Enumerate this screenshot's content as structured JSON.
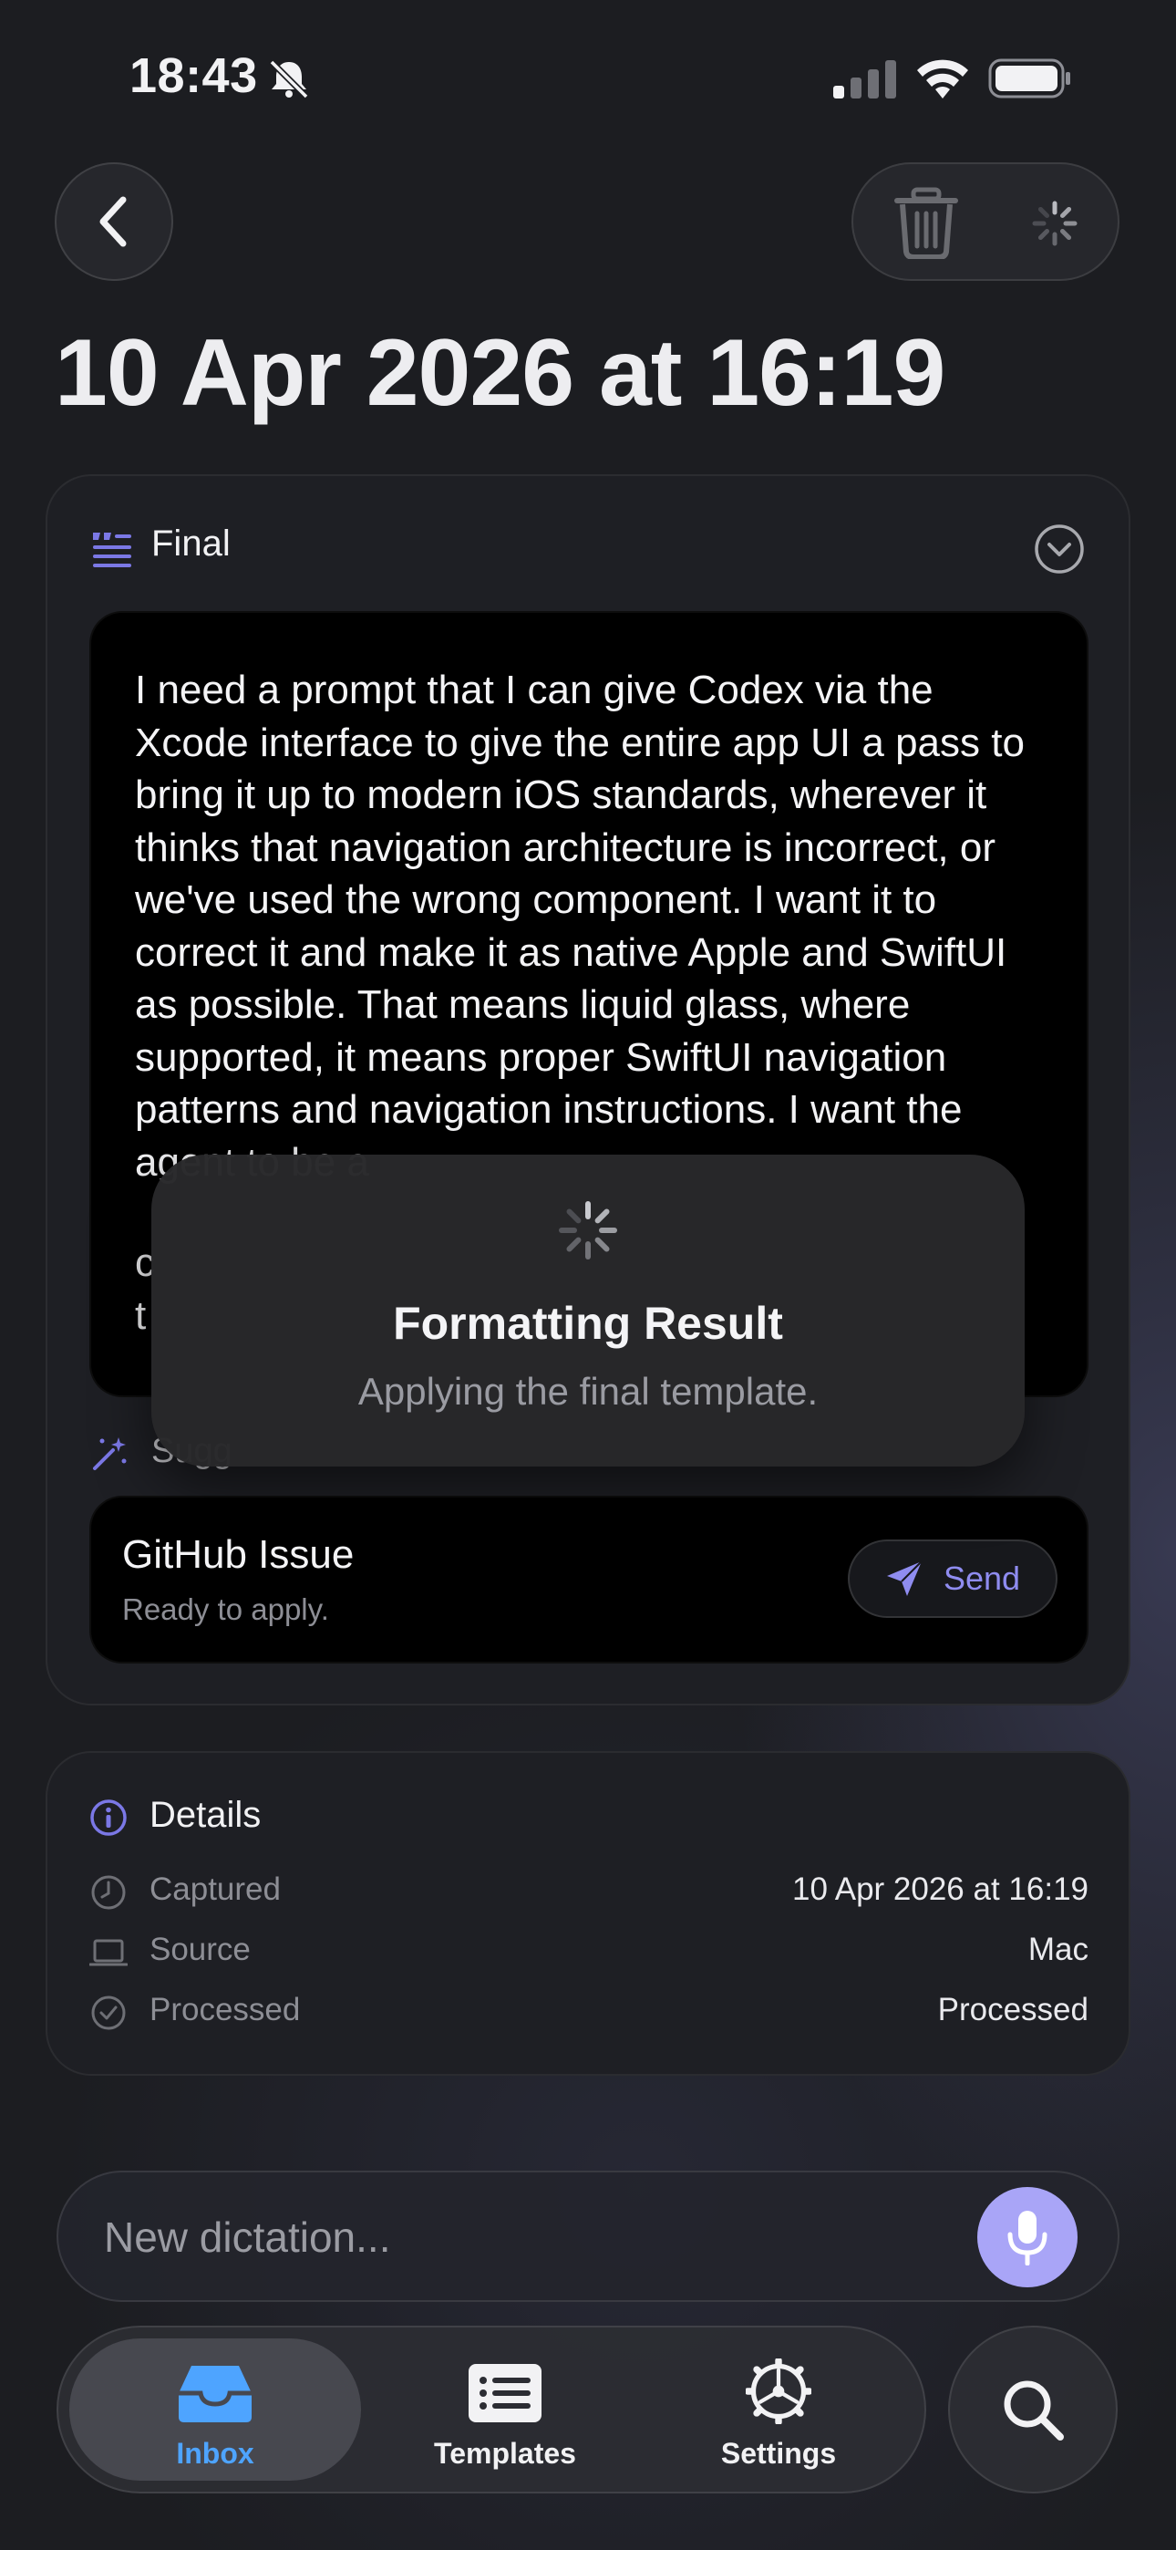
{
  "status_bar": {
    "time": "18:43",
    "icons": [
      "bell-slash-icon",
      "cellular-signal-icon",
      "wifi-icon",
      "battery-icon"
    ]
  },
  "header": {
    "title": "10 Apr 2026 at 16:19",
    "back_icon": "chevron-left-icon",
    "actions": [
      "trash-icon",
      "activity-spinner-icon"
    ]
  },
  "final_section": {
    "label": "Final",
    "icon": "text-quote-icon",
    "collapse_icon": "chevron-down-circle-icon",
    "text": "I need a prompt that I can give Codex via the Xcode interface to give the entire app UI a pass to bring it up to modern iOS standards, wherever it thinks that navigation architecture is incorrect, or we've used the wrong component. I want it to correct it and make it as native Apple and SwiftUI as possible. That means liquid glass, where supported, it means proper SwiftUI navigation patterns and navigation instructions. I want the agent to be a",
    "text_tail_lines": [
      "c",
      "t"
    ]
  },
  "suggestion": {
    "label": "Sugg",
    "icon": "magic-wand-icon",
    "template_name": "GitHub Issue",
    "template_status": "Ready to apply.",
    "send_label": "Send",
    "send_icon": "paper-plane-icon"
  },
  "overlay": {
    "title": "Formatting Result",
    "subtitle": "Applying the final template."
  },
  "details": {
    "label": "Details",
    "icon": "info-circle-icon",
    "rows": [
      {
        "label": "Captured",
        "value": "10 Apr 2026 at 16:19",
        "icon": "clock-icon"
      },
      {
        "label": "Source",
        "value": "Mac",
        "icon": "laptop-icon"
      },
      {
        "label": "Processed",
        "value": "Processed",
        "icon": "checkmark-circle-icon"
      }
    ]
  },
  "dictation": {
    "placeholder": "New dictation...",
    "mic_icon": "microphone-icon"
  },
  "tabs": [
    {
      "label": "Inbox",
      "icon": "tray-icon",
      "selected": true
    },
    {
      "label": "Templates",
      "icon": "list-icon",
      "selected": false
    },
    {
      "label": "Settings",
      "icon": "gear-icon",
      "selected": false
    }
  ],
  "search": {
    "icon": "search-icon"
  },
  "colors": {
    "accent": "#8f8cf0",
    "mic": "#a9a5f7",
    "tab_selected": "#4ea4ff",
    "background": "#1c1d21"
  }
}
